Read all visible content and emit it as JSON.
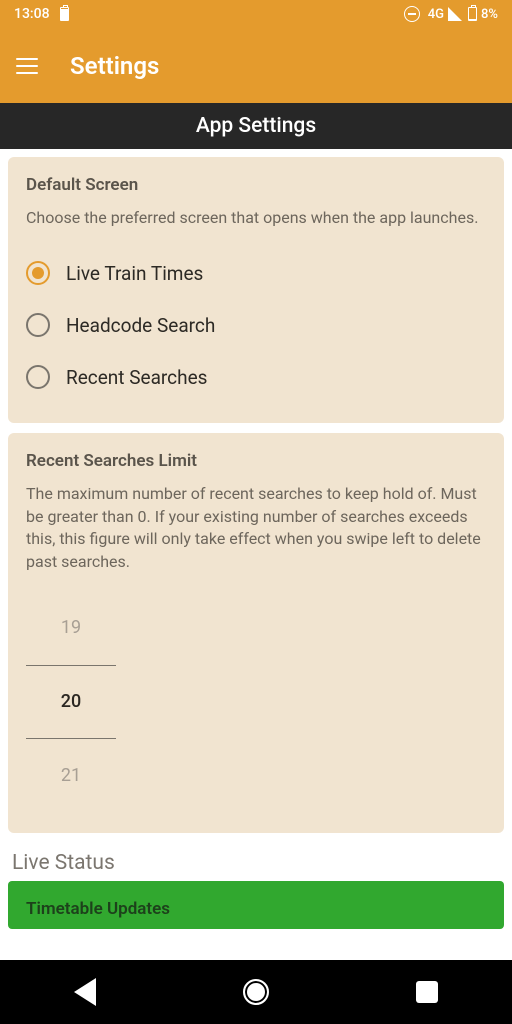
{
  "status": {
    "time": "13:08",
    "network": "4G",
    "battery_pct": "8%"
  },
  "appbar": {
    "title": "Settings"
  },
  "section_header": "App Settings",
  "default_screen": {
    "title": "Default Screen",
    "desc": "Choose the preferred screen that opens when the app launches.",
    "options": [
      {
        "label": "Live Train Times",
        "selected": true
      },
      {
        "label": "Headcode Search",
        "selected": false
      },
      {
        "label": "Recent Searches",
        "selected": false
      }
    ]
  },
  "recent_limit": {
    "title": "Recent Searches Limit",
    "desc": "The maximum number of recent searches to keep hold of. Must be greater than 0. If your existing number of searches exceeds this, this figure will only take effect when you swipe left to delete past searches.",
    "prev": "19",
    "value": "20",
    "next": "21"
  },
  "live_status": {
    "label": "Live Status",
    "timetable_title": "Timetable Updates"
  }
}
